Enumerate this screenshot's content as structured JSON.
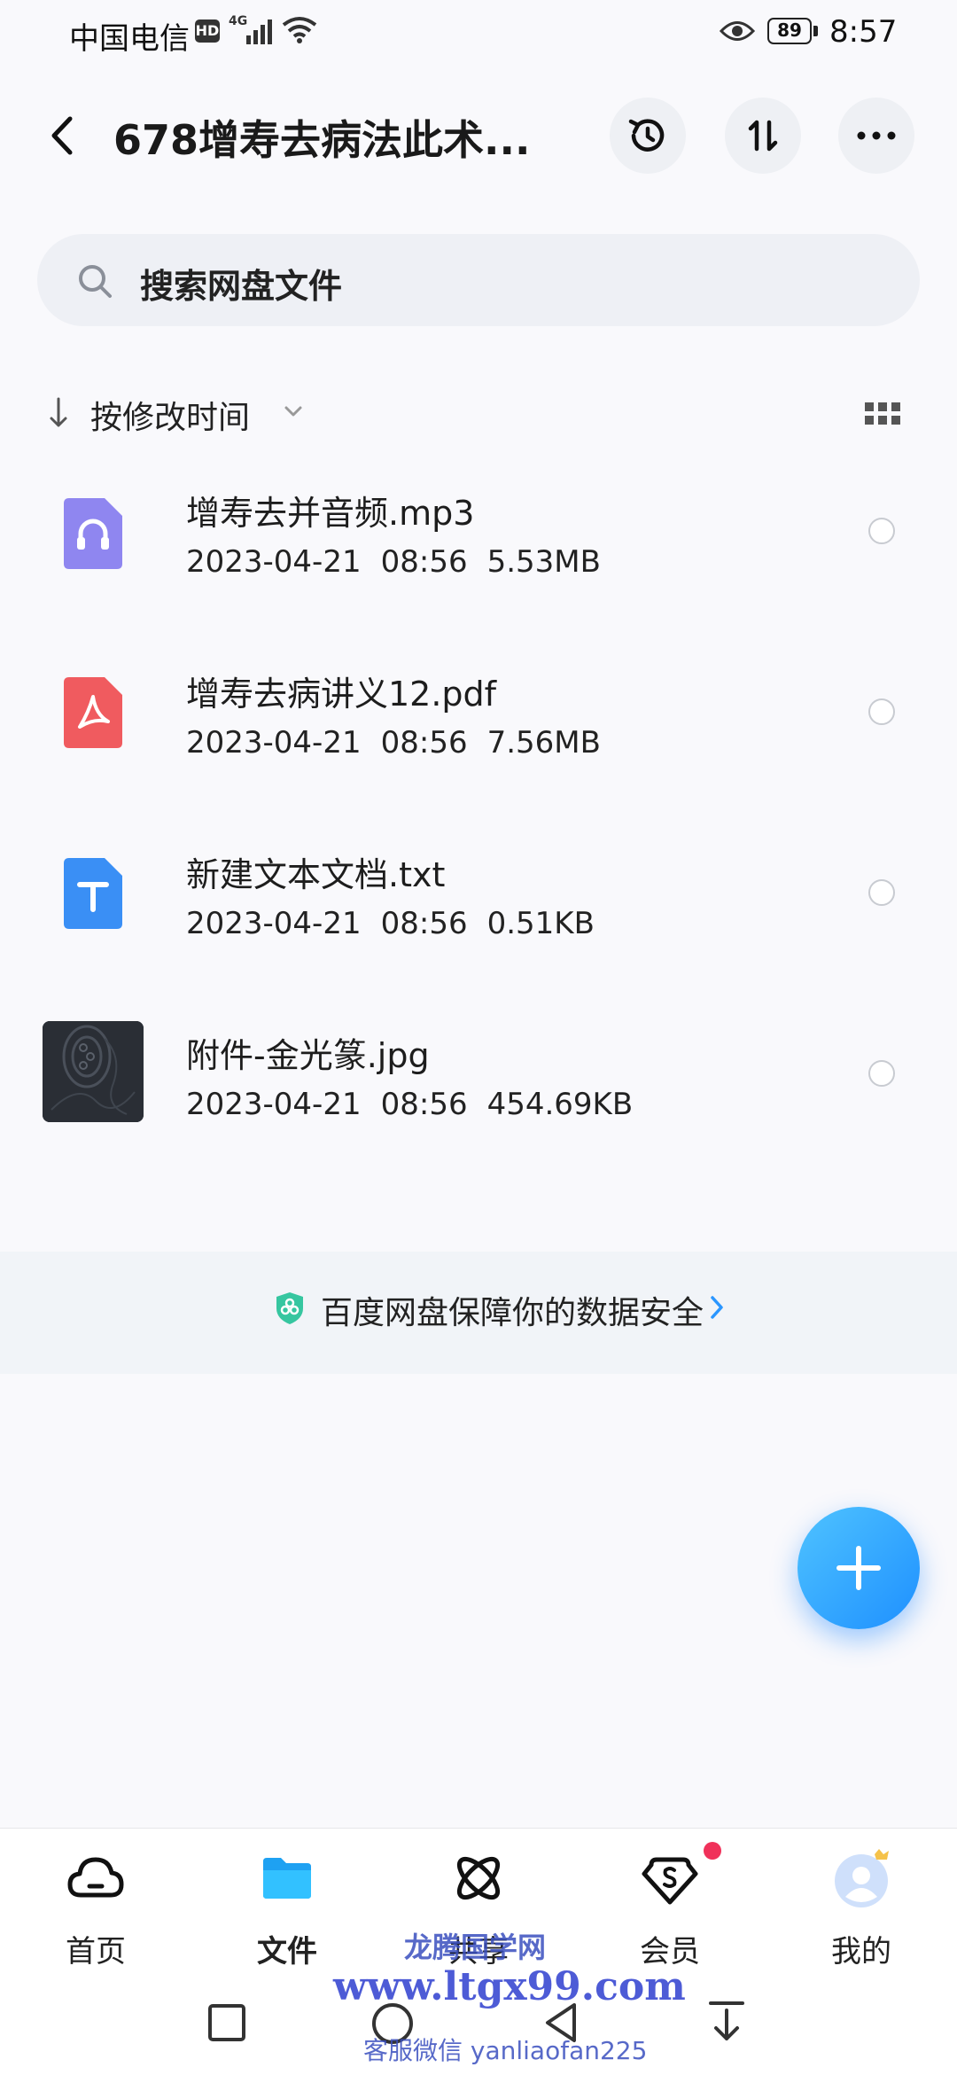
{
  "status_bar": {
    "carrier": "中国电信",
    "hd_badge": "HD",
    "network": "4G",
    "battery": "89",
    "time": "8:57"
  },
  "header": {
    "title": "678增寿去病法此术...",
    "icons": [
      "back-icon",
      "history-icon",
      "sort-icon",
      "more-icon"
    ]
  },
  "search": {
    "placeholder": "搜索网盘文件"
  },
  "sort": {
    "label": "按修改时间"
  },
  "files": [
    {
      "name": "增寿去并音频.mp3",
      "date": "2023-04-21",
      "time": "08:56",
      "size": "5.53MB",
      "icon": "audio-file-icon",
      "color": "#8f86f0"
    },
    {
      "name": "增寿去病讲义12.pdf",
      "date": "2023-04-21",
      "time": "08:56",
      "size": "7.56MB",
      "icon": "pdf-file-icon",
      "color": "#f05b5f"
    },
    {
      "name": "新建文本文档.txt",
      "date": "2023-04-21",
      "time": "08:56",
      "size": "0.51KB",
      "icon": "text-file-icon",
      "color": "#3a8ff5"
    },
    {
      "name": "附件-金光篆.jpg",
      "date": "2023-04-21",
      "time": "08:56",
      "size": "454.69KB",
      "icon": "image-thumbnail",
      "color": "#2b2f36"
    }
  ],
  "security": {
    "text": "百度网盘保障你的数据安全"
  },
  "bottom_nav": [
    {
      "label": "首页",
      "icon": "cloud-home-icon"
    },
    {
      "label": "文件",
      "icon": "folder-icon",
      "active": true
    },
    {
      "label": "共享",
      "icon": "share-atom-icon"
    },
    {
      "label": "会员",
      "icon": "vip-diamond-icon"
    },
    {
      "label": "我的",
      "icon": "avatar-icon"
    }
  ],
  "watermark": {
    "line1": "龙腾国学网",
    "line2": "www.ltgx99.com",
    "line3": "客服微信 yanliaofan225"
  },
  "colors": {
    "accent": "#2a96ff",
    "background": "#f9f9fc",
    "badge_red": "#f0315a"
  }
}
